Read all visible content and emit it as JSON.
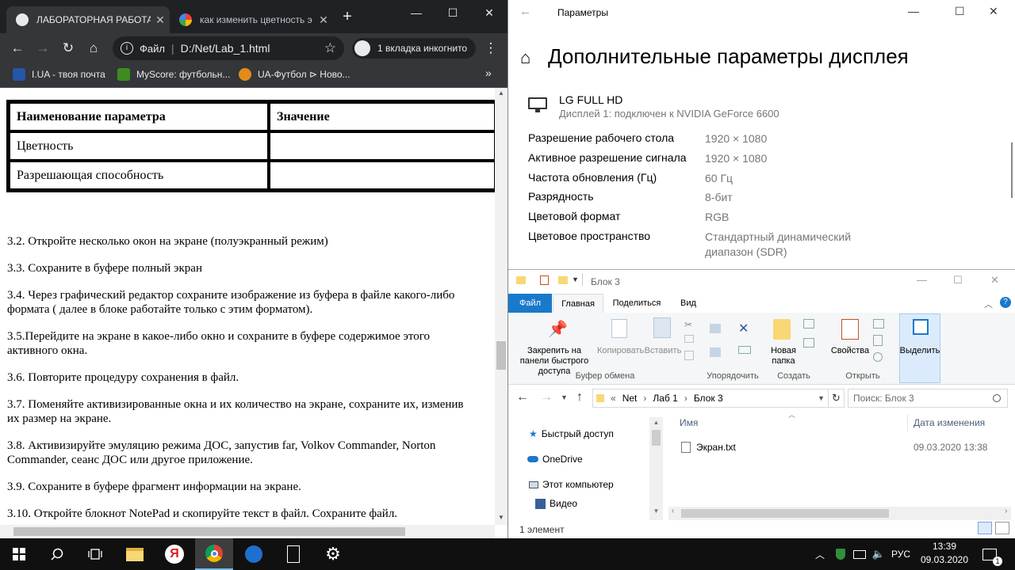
{
  "chrome": {
    "tabs": [
      {
        "label": "ЛАБОРАТОРНАЯ РАБОТА",
        "active": true
      },
      {
        "label": "как изменить цветность э",
        "active": false
      }
    ],
    "new_tab": "+",
    "url_scheme": "Файл",
    "url": "D:/Net/Lab_1.html",
    "incognito": "1 вкладка инкогнито",
    "bookmarks": [
      "I.UA - твоя почта",
      "MyScore: футбольн...",
      "UA-Футбол ⊳ Ново..."
    ],
    "bookmarks_more": "»"
  },
  "document": {
    "table": {
      "headers": [
        "Наименование параметра",
        "Значение"
      ],
      "rows": [
        [
          "Цветность",
          ""
        ],
        [
          "Разрешающая способность",
          ""
        ]
      ]
    },
    "paragraphs": [
      "3.2. Откройте несколько окон на экране (полуэкранный режим)",
      "3.3. Сохраните в буфере полный экран",
      "3.4. Через графический редактор сохраните изображение из буфера в файле какого-либо формата ( далее в блоке работайте только с этим форматом).",
      "3.5.Перейдите на экране в какое-либо окно и сохраните в буфере содержимое этого активного окна.",
      "3.6. Повторите процедуру сохранения в файл.",
      "3.7. Поменяйте активизированные окна и их количество на экране, сохраните их, изменив их размер на экране.",
      "3.8. Активизируйте эмуляцию режима ДОС, запустив far, Volkov Commander, Norton Commander, сеанс ДОС или другое приложение.",
      "3.9. Сохраните в буфере фрагмент информации на экране.",
      "3.10. Откройте блокнот NotePad и скопируйте текст в файл. Сохраните файл."
    ]
  },
  "settings": {
    "window_title": "Параметры",
    "page_title": "Дополнительные параметры дисплея",
    "monitor_name": "LG FULL HD",
    "monitor_desc": "Дисплей 1: подключен к NVIDIA GeForce 6600",
    "rows": [
      {
        "label": "Разрешение рабочего стола",
        "value": "1920 × 1080"
      },
      {
        "label": "Активное разрешение сигнала",
        "value": "1920 × 1080"
      },
      {
        "label": "Частота обновления (Гц)",
        "value": "60 Гц"
      },
      {
        "label": "Разрядность",
        "value": "8-бит"
      },
      {
        "label": "Цветовой формат",
        "value": "RGB"
      },
      {
        "label": "Цветовое пространство",
        "value": "Стандартный динамический диапазон (SDR)"
      }
    ]
  },
  "explorer": {
    "window_title": "Блок 3",
    "ribbon_tabs": [
      "Файл",
      "Главная",
      "Поделиться",
      "Вид"
    ],
    "buttons": {
      "pin": "Закрепить на панели быстрого доступа",
      "copy": "Копировать",
      "paste": "Вставить",
      "new_folder": "Новая папка",
      "properties": "Свойства",
      "select": "Выделить"
    },
    "groups": [
      "Буфер обмена",
      "Упорядочить",
      "Создать",
      "Открыть"
    ],
    "breadcrumb": [
      "Net",
      "Лаб 1",
      "Блок 3"
    ],
    "search_placeholder": "Поиск: Блок 3",
    "nav": [
      "Быстрый доступ",
      "OneDrive",
      "Этот компьютер",
      "Видео"
    ],
    "columns": [
      "Имя",
      "Дата изменения"
    ],
    "files": [
      {
        "name": "Экран.txt",
        "date": "09.03.2020 13:38"
      }
    ],
    "status": "1 элемент"
  },
  "taskbar": {
    "lang": "РУС",
    "time": "13:39",
    "date": "09.03.2020",
    "notifications": "1"
  }
}
